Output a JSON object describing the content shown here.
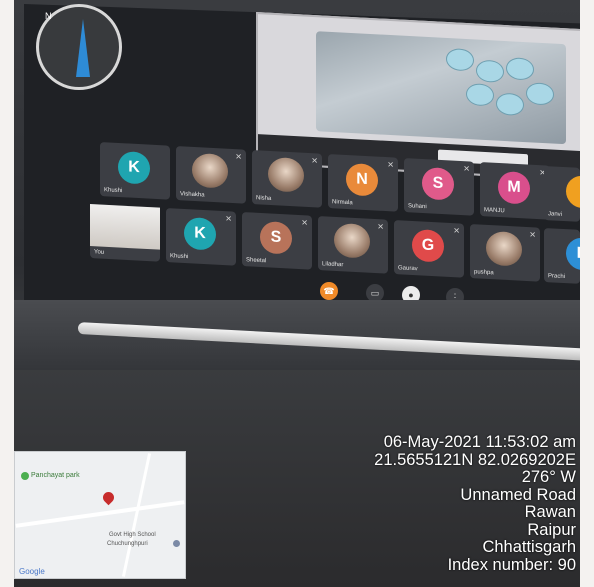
{
  "geotag": {
    "datetime": "06-May-2021 11:53:02 am",
    "coordinates": "21.5655121N 82.0269202E",
    "heading": "276° W",
    "road": "Unnamed Road",
    "locality": "Rawan",
    "district": "Raipur",
    "state": "Chhattisgarh",
    "index": "Index number: 90"
  },
  "minimap": {
    "park_label": "Panchayat park",
    "school_label": "Govt High School",
    "village_label": "Chuchunghpuri",
    "brand": "Google"
  },
  "participants": [
    {
      "initial": "K",
      "name": "Khushi",
      "color": "#1fa5b0"
    },
    {
      "initial": "",
      "name": "Vishakha",
      "color": ""
    },
    {
      "initial": "",
      "name": "Nisha",
      "color": ""
    },
    {
      "initial": "N",
      "name": "Nirmala",
      "color": "#e98a3a"
    },
    {
      "initial": "S",
      "name": "Suhani",
      "color": "#e05a8a"
    },
    {
      "initial": "M",
      "name": "MANJU",
      "color": "#d94f8c"
    },
    {
      "initial": "",
      "name": "Janvi",
      "color": "#f0a020"
    },
    {
      "initial": "",
      "name": "You",
      "color": ""
    },
    {
      "initial": "K",
      "name": "Khushi",
      "color": "#1fa5b0"
    },
    {
      "initial": "S",
      "name": "Sheetal",
      "color": "#b8735a"
    },
    {
      "initial": "",
      "name": "Liladhar",
      "color": ""
    },
    {
      "initial": "G",
      "name": "Gaurav",
      "color": "#e04a4a"
    },
    {
      "initial": "",
      "name": "pushpa",
      "color": ""
    },
    {
      "initial": "P",
      "name": "Prachi",
      "color": "#2d8fd6"
    }
  ],
  "compass": {
    "north_label": "N"
  }
}
